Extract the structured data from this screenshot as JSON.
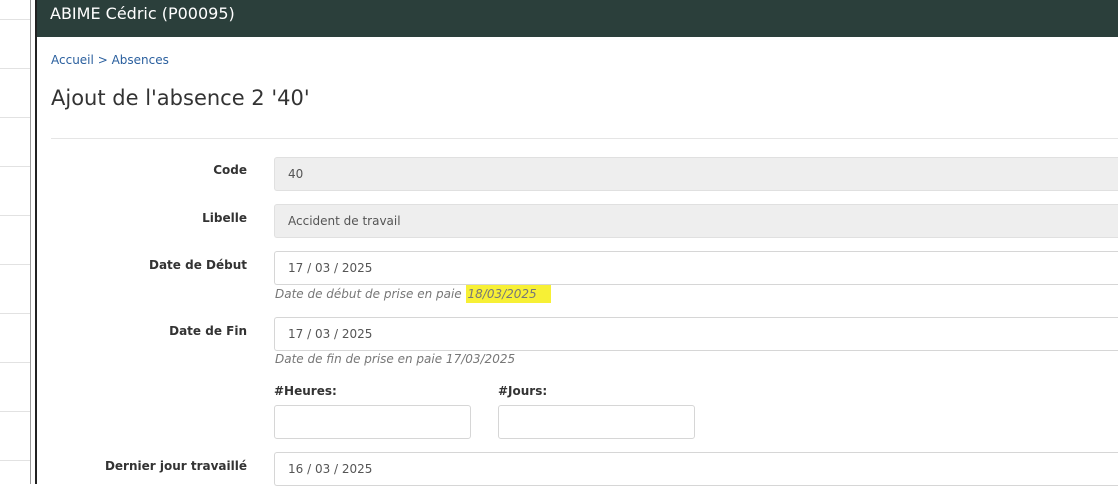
{
  "header": {
    "title": "ABIME Cédric (P00095)"
  },
  "breadcrumb": {
    "home": "Accueil",
    "separator": ">",
    "current": "Absences"
  },
  "page_title": "Ajout de l'absence 2 '40'",
  "form": {
    "code": {
      "label": "Code",
      "value": "40"
    },
    "libelle": {
      "label": "Libelle",
      "value": "Accident de travail"
    },
    "date_debut": {
      "label": "Date de Début",
      "value": "17 / 03 / 2025",
      "help_prefix": "Date de début de prise en paie",
      "help_date": "18/03/2025",
      "highlight_color": "#f7f035"
    },
    "date_fin": {
      "label": "Date de Fin",
      "value": "17 / 03 / 2025",
      "help": "Date de fin de prise en paie 17/03/2025"
    },
    "heures": {
      "label": "#Heures:",
      "value": ""
    },
    "jours": {
      "label": "#Jours:",
      "value": ""
    },
    "dernier_jour": {
      "label": "Dernier jour travaillé",
      "value": "16 / 03 / 2025"
    }
  },
  "colors": {
    "header_bg": "#2b3f3b",
    "link": "#2a5f9e",
    "readonly_bg": "#eeeeee"
  }
}
